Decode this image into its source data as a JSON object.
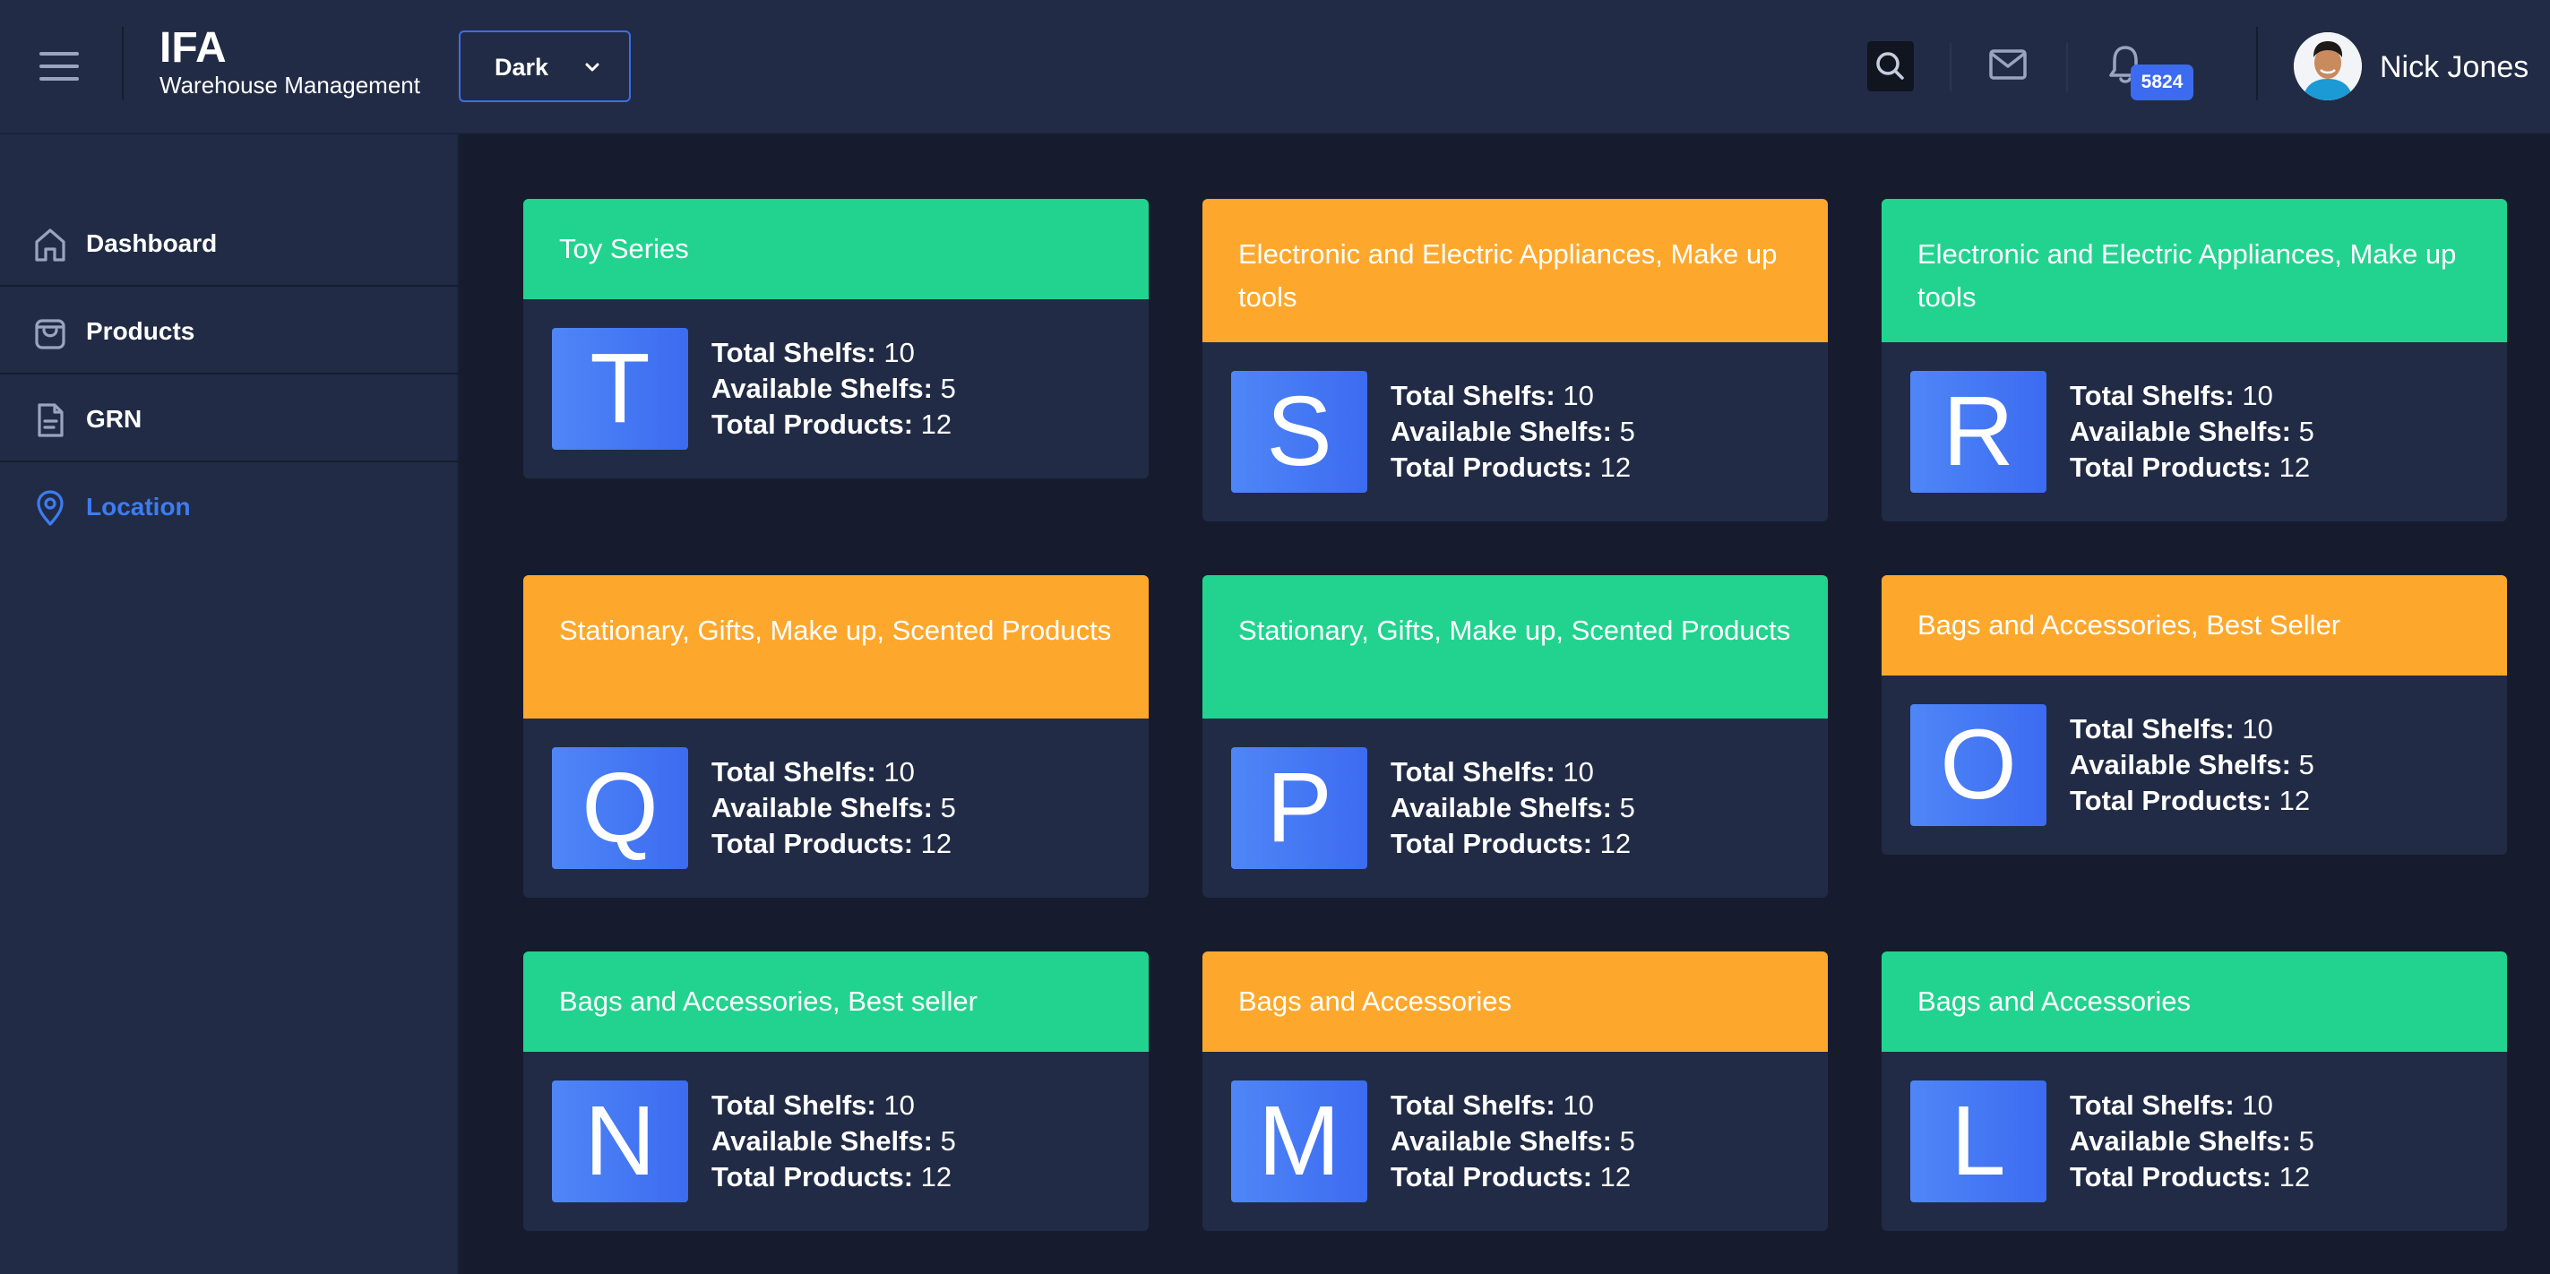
{
  "header": {
    "brand_title": "IFA",
    "brand_subtitle": "Warehouse Management",
    "theme_select_value": "Dark",
    "notification_count": "5824",
    "user_name": "Nick Jones"
  },
  "sidebar": {
    "items": [
      {
        "label": "Dashboard",
        "icon": "home-icon",
        "active": false
      },
      {
        "label": "Products",
        "icon": "shopping-bag-icon",
        "active": false
      },
      {
        "label": "GRN",
        "icon": "document-icon",
        "active": false
      },
      {
        "label": "Location",
        "icon": "location-pin-icon",
        "active": true
      }
    ]
  },
  "colors": {
    "green": "#22d38f",
    "orange": "#fda82d",
    "accent": "#3c6bf0",
    "panel": "#212b45",
    "background": "#161c2e"
  },
  "stat_labels": {
    "total_shelfs": "Total Shelfs:",
    "available_shelfs": "Available Shelfs:",
    "total_products": "Total Products:"
  },
  "cards": [
    {
      "title": "Toy Series",
      "color": "green",
      "letter": "T",
      "total_shelfs": "10",
      "available_shelfs": "5",
      "total_products": "12"
    },
    {
      "title": "Electronic and Electric Appliances, Make up tools",
      "color": "orange",
      "letter": "S",
      "total_shelfs": "10",
      "available_shelfs": "5",
      "total_products": "12"
    },
    {
      "title": "Electronic and Electric Appliances, Make up tools",
      "color": "green",
      "letter": "R",
      "total_shelfs": "10",
      "available_shelfs": "5",
      "total_products": "12"
    },
    {
      "title": "Stationary, Gifts, Make up, Scented Products",
      "color": "orange",
      "letter": "Q",
      "total_shelfs": "10",
      "available_shelfs": "5",
      "total_products": "12"
    },
    {
      "title": "Stationary, Gifts, Make up, Scented Products",
      "color": "green",
      "letter": "P",
      "total_shelfs": "10",
      "available_shelfs": "5",
      "total_products": "12"
    },
    {
      "title": "Bags and Accessories, Best Seller",
      "color": "orange",
      "letter": "O",
      "total_shelfs": "10",
      "available_shelfs": "5",
      "total_products": "12"
    },
    {
      "title": "Bags and Accessories, Best seller",
      "color": "green",
      "letter": "N",
      "total_shelfs": "10",
      "available_shelfs": "5",
      "total_products": "12"
    },
    {
      "title": "Bags and Accessories",
      "color": "orange",
      "letter": "M",
      "total_shelfs": "10",
      "available_shelfs": "5",
      "total_products": "12"
    },
    {
      "title": "Bags and Accessories",
      "color": "green",
      "letter": "L",
      "total_shelfs": "10",
      "available_shelfs": "5",
      "total_products": "12"
    }
  ]
}
